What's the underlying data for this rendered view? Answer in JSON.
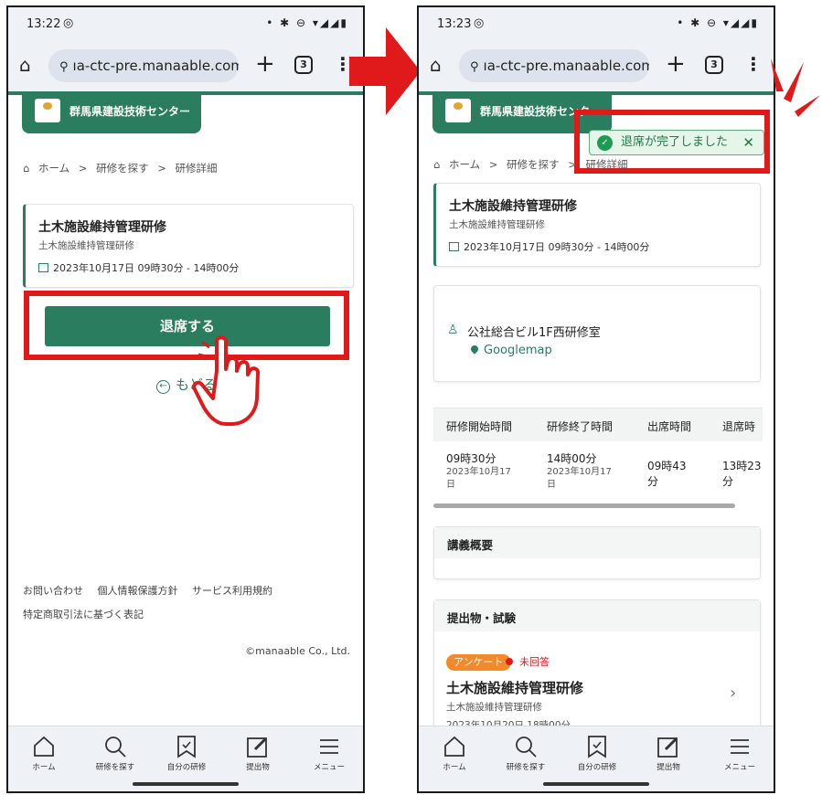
{
  "colors": {
    "brand": "#2a7d5f",
    "highlight": "#e0191b",
    "toast_bg": "#e5f5ea",
    "survey_pill": "#f28a2c"
  },
  "left": {
    "status_time": "13:22",
    "url": "ıa-ctc-pre.manaable.com",
    "tab_count": "3",
    "brand_name": "群馬県建設技術センター",
    "breadcrumb": [
      "ホーム",
      ">",
      "研修を探す",
      ">",
      "研修詳細"
    ],
    "course": {
      "title": "土木施設維持管理研修",
      "subtitle": "土木施設維持管理研修",
      "date": "2023年10月17日 09時30分 - 14時00分"
    },
    "leave_button": "退席する",
    "back_link": "もどる",
    "footer_links": [
      "お問い合わせ",
      "個人情報保護方針",
      "サービス利用規約"
    ],
    "footer_link2": "特定商取引法に基づく表記",
    "copyright": "©manaable Co., Ltd."
  },
  "right": {
    "status_time": "13:23",
    "url": "ıa-ctc-pre.manaable.com",
    "tab_count": "3",
    "brand_name": "群馬県建設技術センター",
    "toast": "退席が完了しました",
    "breadcrumb": [
      "ホーム",
      ">",
      "研修を探す",
      ">",
      "研修詳細"
    ],
    "course": {
      "title": "土木施設維持管理研修",
      "subtitle": "土木施設維持管理研修",
      "date": "2023年10月17日 09時30分 - 14時00分"
    },
    "location": {
      "place": "公社総合ビル1F西研修室",
      "map_link": "Googlemap"
    },
    "time_table": {
      "headers": [
        "研修開始時間",
        "研修終了時間",
        "出席時間",
        "退席時"
      ],
      "start_time": "09時30分",
      "start_date_line1": "2023年10月17",
      "start_date_line2": "日",
      "end_time": "14時00分",
      "end_date_line1": "2023年10月17",
      "end_date_line2": "日",
      "attend_line1": "09時43",
      "attend_line2": "分",
      "leave_line1": "13時23",
      "leave_line2": "分"
    },
    "lecture_overview": "講義概要",
    "submissions": {
      "header": "提出物・試験",
      "tag": "アンケート",
      "status": "未回答",
      "title": "土木施設維持管理研修",
      "subtitle": "土木施設維持管理研修",
      "date": "2023年10月20日 18時00分"
    }
  },
  "nav": {
    "home": "ホーム",
    "search": "研修を探す",
    "my_courses": "自分の研修",
    "submissions": "提出物",
    "menu": "メニュー"
  },
  "icons": [
    "home-icon",
    "search-icon",
    "bookmark-icon",
    "edit-icon",
    "menu-icon",
    "calendar-icon",
    "location-pin-icon",
    "check-circle-icon",
    "close-icon",
    "chevron-right-icon",
    "tap-hand-icon",
    "right-arrow-icon"
  ]
}
